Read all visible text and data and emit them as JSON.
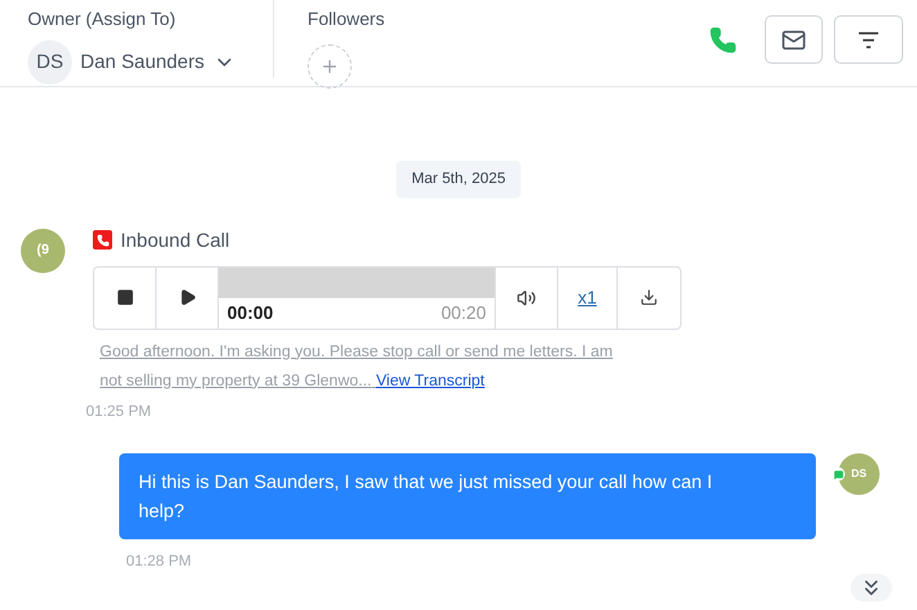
{
  "header": {
    "owner_label": "Owner (Assign To)",
    "owner_initials": "DS",
    "owner_name": "Dan Saunders",
    "followers_label": "Followers"
  },
  "date_divider": "Mar 5th, 2025",
  "messages": [
    {
      "kind": "call",
      "avatar": "(9",
      "title": "Inbound Call",
      "elapsed": "00:00",
      "duration": "00:20",
      "speed": "x1",
      "transcript": "Good afternoon. I'm asking you. Please stop call or send me letters. I am not selling my property at 39 Glenwo...",
      "transcript_link": "View Transcript",
      "time": "01:25 PM"
    },
    {
      "kind": "outgoing",
      "avatar": "DS",
      "text": "Hi this is Dan Saunders, I saw that we just missed your call how can I help?",
      "time": "01:28 PM"
    }
  ]
}
